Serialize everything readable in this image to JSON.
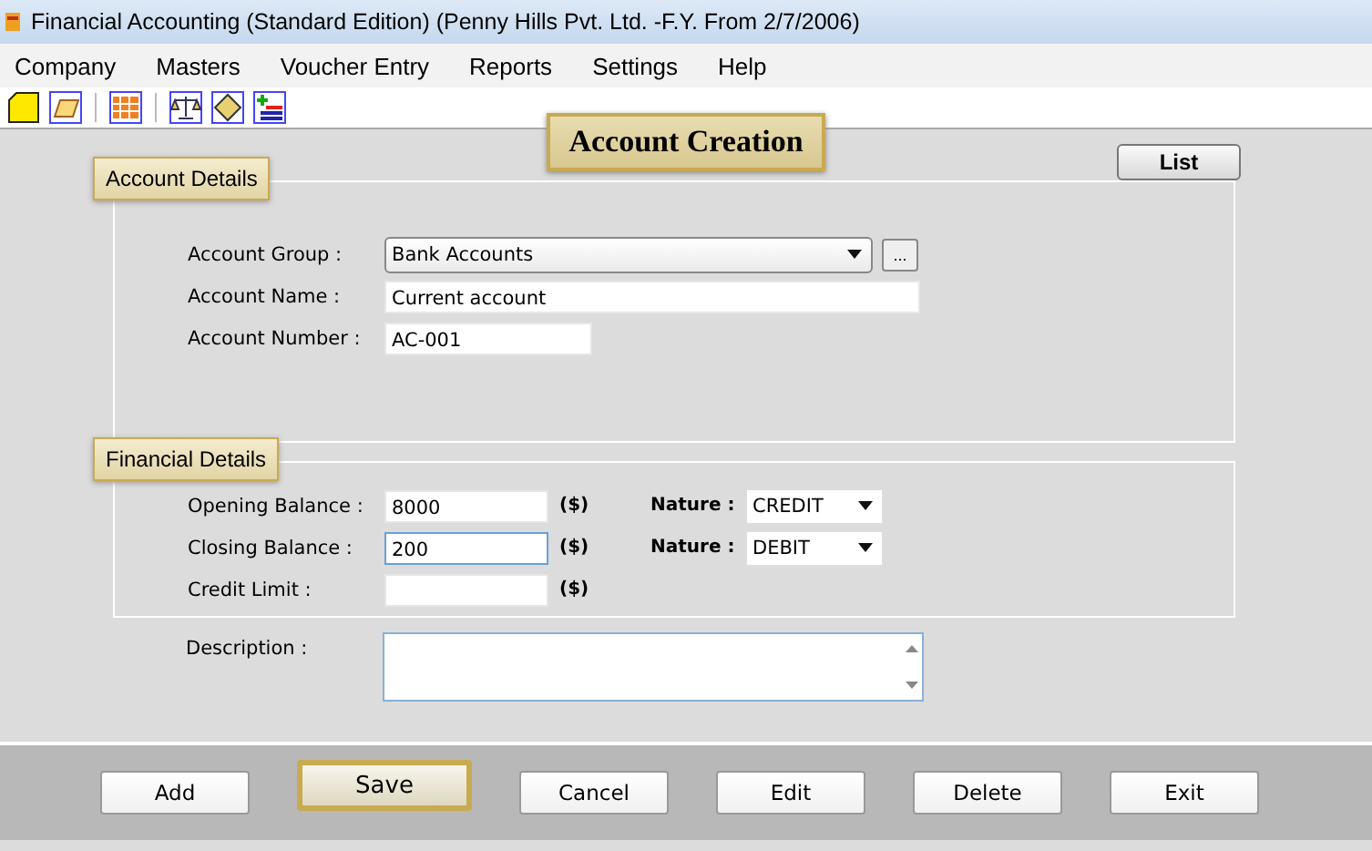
{
  "window": {
    "title": "Financial Accounting (Standard Edition) (Penny Hills Pvt. Ltd. -F.Y. From 2/7/2006)"
  },
  "menu": [
    "Company",
    "Masters",
    "Voucher Entry",
    "Reports",
    "Settings",
    "Help"
  ],
  "heading": "Account Creation",
  "list_button": "List",
  "account_details": {
    "title": "Account Details",
    "group": {
      "label": "Account Group :",
      "value": "Bank Accounts",
      "browse": "..."
    },
    "name": {
      "label": "Account Name :",
      "value": "Current account"
    },
    "number": {
      "label": "Account Number :",
      "value": "AC-001"
    }
  },
  "financial_details": {
    "title": "Financial Details",
    "rows": [
      {
        "label": "Opening Balance :",
        "value": "8000",
        "unit": "($)",
        "focused": false,
        "nature_label": "Nature :",
        "nature": "CREDIT"
      },
      {
        "label": "Closing Balance :",
        "value": "200",
        "unit": "($)",
        "focused": true,
        "nature_label": "Nature :",
        "nature": "DEBIT"
      },
      {
        "label": "Credit Limit :",
        "value": "",
        "unit": "($)",
        "focused": false
      }
    ]
  },
  "description": {
    "label": "Description :"
  },
  "buttons": [
    {
      "label": "Add",
      "selected": false
    },
    {
      "label": "Save",
      "selected": true
    },
    {
      "label": "Cancel",
      "selected": false
    },
    {
      "label": "Edit",
      "selected": false
    },
    {
      "label": "Delete",
      "selected": false
    },
    {
      "label": "Exit",
      "selected": false
    }
  ]
}
